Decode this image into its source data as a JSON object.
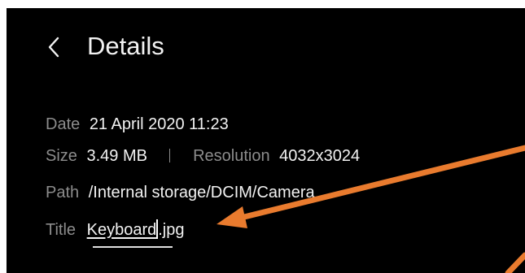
{
  "header": {
    "title": "Details"
  },
  "details": {
    "date": {
      "label": "Date",
      "value": "21 April 2020 11:23"
    },
    "size": {
      "label": "Size",
      "value": "3.49 MB"
    },
    "resolution": {
      "label": "Resolution",
      "value": "4032x3024"
    },
    "path": {
      "label": "Path",
      "value": "/Internal storage/DCIM/Camera"
    },
    "title_field": {
      "label": "Title",
      "name": "Keyboard",
      "extension": ".jpg"
    }
  },
  "icons": {
    "back": "chevron-left-icon",
    "annotation": "orange-arrow"
  },
  "colors": {
    "background": "#000000",
    "text": "#f2f2f2",
    "label": "#8c8c8c",
    "annotation_arrow": "#e97b2e"
  }
}
